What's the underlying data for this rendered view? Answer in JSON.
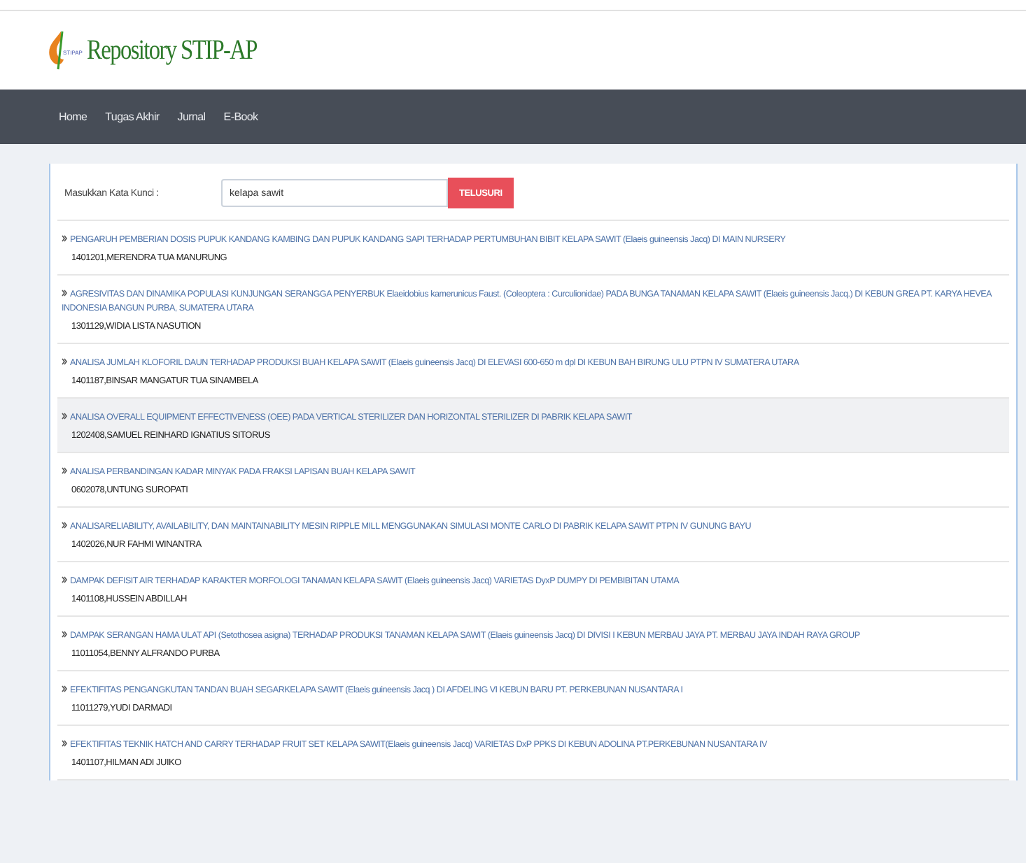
{
  "logo": {
    "text": "Repository STIP-AP",
    "mark_text": "STIPAP"
  },
  "nav": {
    "items": [
      {
        "label": "Home"
      },
      {
        "label": "Tugas Akhir"
      },
      {
        "label": "Jurnal"
      },
      {
        "label": "E-Book"
      }
    ]
  },
  "search": {
    "label": "Masukkan Kata Kunci :",
    "value": "kelapa sawit",
    "button": "TELUSURI"
  },
  "results": [
    {
      "title": "PENGARUH PEMBERIAN DOSIS PUPUK KANDANG KAMBING DAN PUPUK KANDANG SAPI TERHADAP PERTUMBUHAN BIBIT KELAPA SAWIT (Elaeis guineensis Jacq) DI MAIN NURSERY",
      "author": "1401201,MERENDRA TUA MANURUNG",
      "highlighted": false
    },
    {
      "title": "AGRESIVITAS DAN DINAMIKA POPULASI KUNJUNGAN SERANGGA PENYERBUK Elaeidobius kamerunicus Faust. (Coleoptera : Curculionidae) PADA BUNGA TANAMAN KELAPA SAWIT (Elaeis guineensis Jacq.) DI KEBUN GREA PT. KARYA HEVEA INDONESIA BANGUN PURBA, SUMATERA UTARA",
      "author": "1301129,WIDIA LISTA NASUTION",
      "highlighted": false
    },
    {
      "title": "ANALISA JUMLAH KLOFORIL DAUN TERHADAP PRODUKSI BUAH KELAPA SAWIT (Elaeis guineensis Jacq) DI ELEVASI 600-650 m dpl DI KEBUN BAH BIRUNG ULU PTPN IV SUMATERA UTARA",
      "author": "1401187,BINSAR MANGATUR TUA SINAMBELA",
      "highlighted": false
    },
    {
      "title": "ANALISA OVERALL EQUIPMENT EFFECTIVENESS (OEE) PADA VERTICAL STERILIZER DAN HORIZONTAL STERILIZER DI PABRIK KELAPA SAWIT",
      "author": "1202408,SAMUEL REINHARD IGNATIUS SITORUS",
      "highlighted": true
    },
    {
      "title": "ANALISA PERBANDINGAN KADAR MINYAK PADA FRAKSI LAPISAN BUAH KELAPA SAWIT",
      "author": "0602078,UNTUNG SUROPATI",
      "highlighted": false
    },
    {
      "title": "ANALISARELIABILITY, AVAILABILITY, DAN MAINTAINABILITY MESIN RIPPLE MILL MENGGUNAKAN SIMULASI MONTE CARLO DI PABRIK KELAPA SAWIT PTPN IV GUNUNG BAYU",
      "author": "1402026,NUR FAHMI WINANTRA",
      "highlighted": false
    },
    {
      "title": "DAMPAK DEFISIT AIR TERHADAP KARAKTER MORFOLOGI TANAMAN KELAPA SAWIT (Elaeis guineensis Jacq) VARIETAS DyxP DUMPY DI PEMBIBITAN UTAMA",
      "author": "1401108,HUSSEIN ABDILLAH",
      "highlighted": false
    },
    {
      "title": "DAMPAK SERANGAN HAMA ULAT API (Setothosea asigna) TERHADAP PRODUKSI TANAMAN KELAPA SAWIT (Elaeis guineensis Jacq) DI DIVISI I KEBUN MERBAU JAYA PT. MERBAU JAYA INDAH RAYA GROUP",
      "author": "11011054,BENNY ALFRANDO PURBA",
      "highlighted": false
    },
    {
      "title": "EFEKTIFITAS PENGANGKUTAN TANDAN BUAH SEGARKELAPA SAWIT (Elaeis guineensis Jacq ) DI AFDELING VI KEBUN BARU PT. PERKEBUNAN NUSANTARA I",
      "author": "11011279,YUDI DARMADI",
      "highlighted": false
    },
    {
      "title": "EFEKTIFITAS TEKNIK HATCH AND CARRY TERHADAP FRUIT SET KELAPA SAWIT(Elaeis guineensis Jacq) VARIETAS DxP PPKS DI KEBUN ADOLINA PT.PERKEBUNAN NUSANTARA IV",
      "author": "1401107,HILMAN ADI JUIKO",
      "highlighted": false
    }
  ]
}
